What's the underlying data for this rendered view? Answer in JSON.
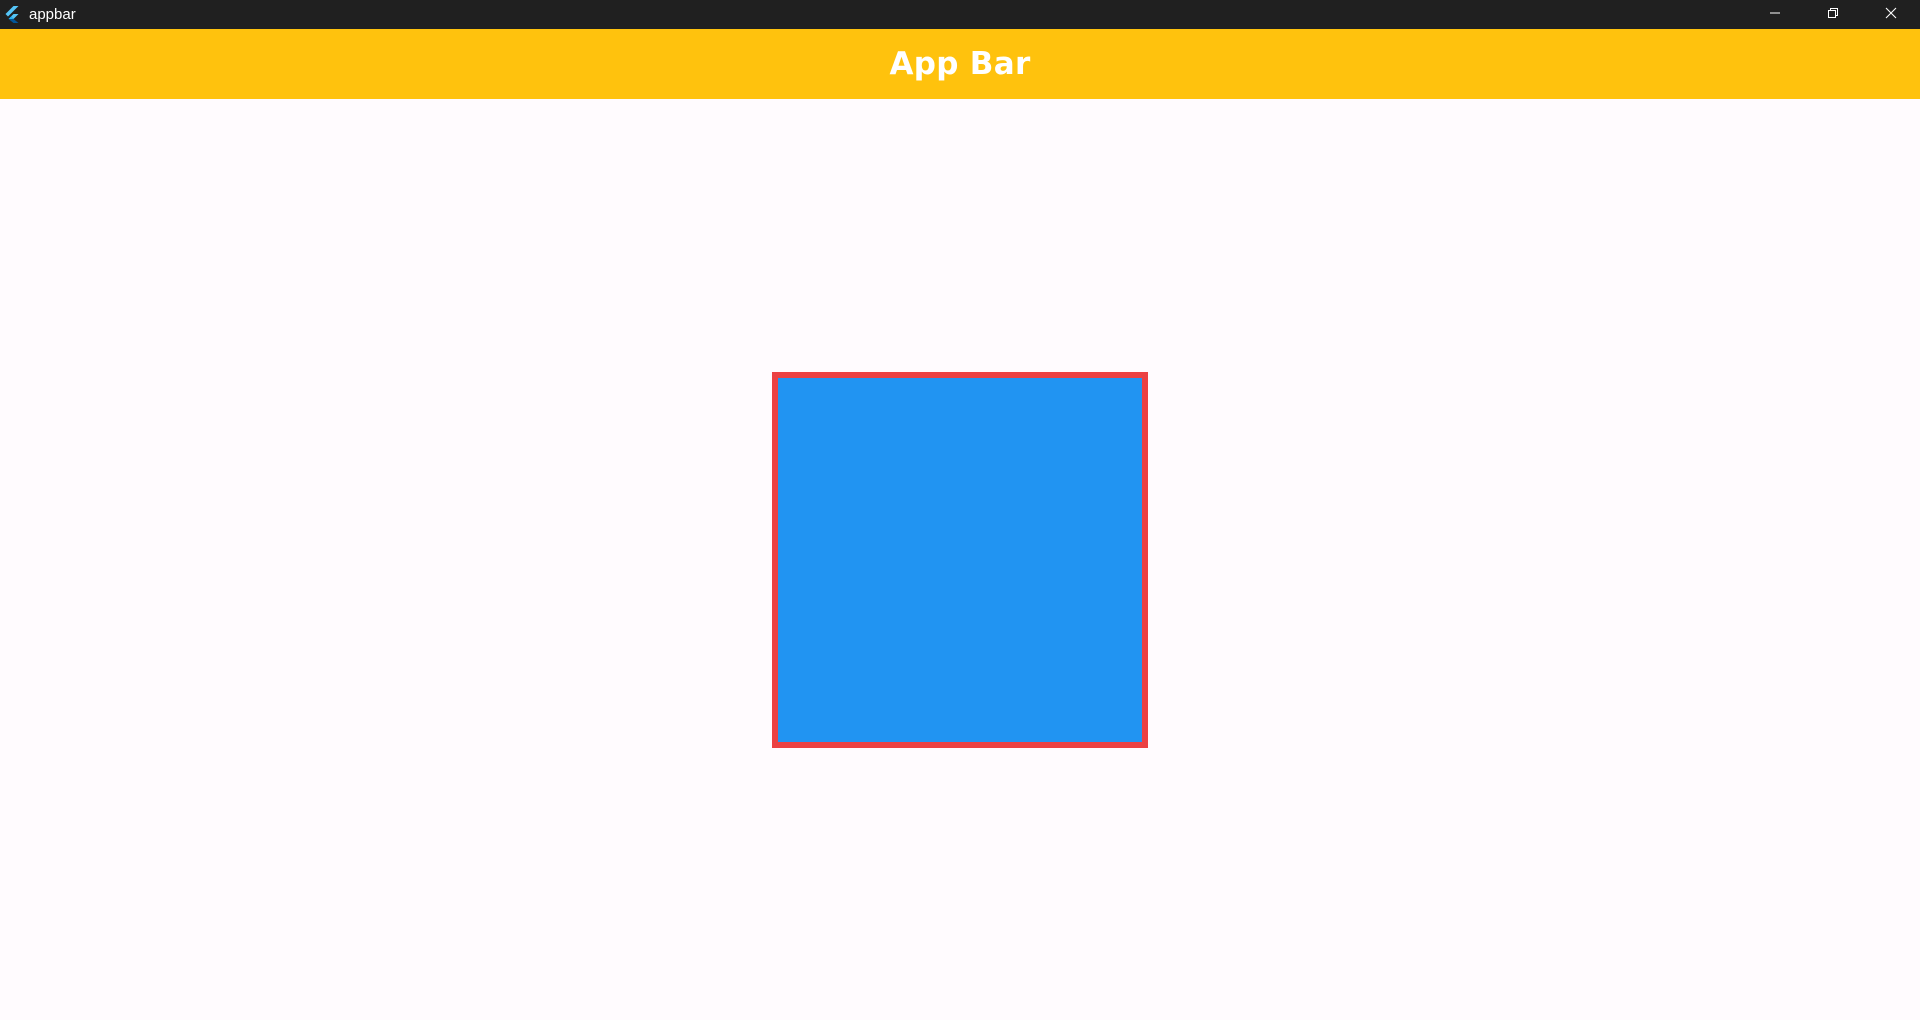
{
  "window": {
    "title": "appbar",
    "icon": "flutter-logo-icon",
    "controls": {
      "minimize_icon": "minimize-icon",
      "restore_icon": "restore-icon",
      "close_icon": "close-icon"
    }
  },
  "appbar": {
    "title": "App Bar",
    "background_color": "#ffc20d",
    "title_color": "#ffffff"
  },
  "content": {
    "background_color": "#fffbfe",
    "box": {
      "fill_color": "#2194f2",
      "border_color": "#eb4143"
    }
  }
}
